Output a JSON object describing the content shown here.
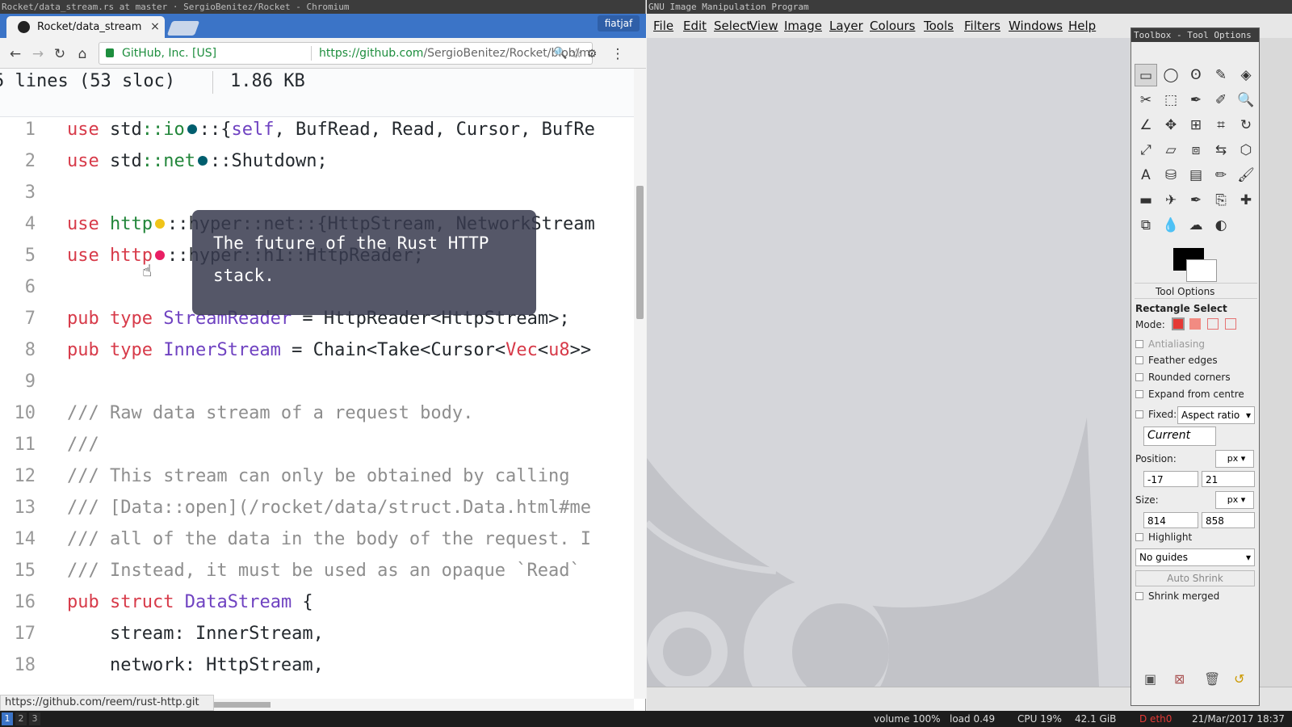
{
  "chrome": {
    "window_title": "Rocket/data_stream.rs at master · SergioBenitez/Rocket - Chromium",
    "tab_title": "Rocket/data_stream",
    "tab_close": "×",
    "profile": "fiatjaf",
    "nav": {
      "back": "←",
      "forward": "→",
      "reload": "↻",
      "home": "⌂",
      "menu": "⋮",
      "zoom": "🔍",
      "star": "☆",
      "ext": "⚙"
    },
    "secure_label": "GitHub, Inc. [US]",
    "url_host": "https://github.com",
    "url_path": "/SergioBenitez/Rocket/blob/master/lib/src/da",
    "status_url": "https://github.com/reem/rust-http.git",
    "file_info": {
      "lines": "5 lines (53 sloc)",
      "size": "1.86 KB"
    },
    "tooltip": "The future of the Rust HTTP stack.",
    "code_lines": [
      {
        "n": "1",
        "segs": [
          [
            "kw",
            "use"
          ],
          [
            "",
            "std"
          ],
          [
            "md",
            "::io"
          ],
          [
            "dot",
            "#005e6e"
          ],
          [
            "",
            "::{"
          ],
          [
            "ty",
            "self"
          ],
          [
            "",
            ", BufRead, Read, Cursor, BufRe"
          ]
        ]
      },
      {
        "n": "2",
        "segs": [
          [
            "kw",
            "use"
          ],
          [
            "",
            "std"
          ],
          [
            "md",
            "::net"
          ],
          [
            "dot",
            "#005e6e"
          ],
          [
            "",
            "::Shutdown;"
          ]
        ]
      },
      {
        "n": "3",
        "segs": []
      },
      {
        "n": "4",
        "segs": [
          [
            "kw",
            "use"
          ],
          [
            "md",
            "http"
          ],
          [
            "dot",
            "#f0c419"
          ],
          [
            "",
            "::hyper::net::{HttpStream, NetworkStream"
          ]
        ]
      },
      {
        "n": "5",
        "segs": [
          [
            "kw",
            "use"
          ],
          [
            "kw",
            "http"
          ],
          [
            "dot",
            "#e91e63"
          ],
          [
            "",
            "::hyper::h1::HttpReader;"
          ]
        ]
      },
      {
        "n": "6",
        "segs": []
      },
      {
        "n": "7",
        "segs": [
          [
            "kw",
            "pub"
          ],
          [
            "kw",
            "type"
          ],
          [
            "ty",
            "StreamReader"
          ],
          [
            "",
            " = HttpReader<HttpStream>;"
          ]
        ]
      },
      {
        "n": "8",
        "segs": [
          [
            "kw",
            "pub"
          ],
          [
            "kw",
            "type"
          ],
          [
            "ty",
            "InnerStream"
          ],
          [
            "",
            " = Chain<Take<Cursor<"
          ],
          [
            "kw",
            "Vec"
          ],
          [
            "",
            "<"
          ],
          [
            "kw",
            "u8"
          ],
          [
            "",
            ">>"
          ]
        ]
      },
      {
        "n": "9",
        "segs": []
      },
      {
        "n": "10",
        "segs": [
          [
            "cm",
            "/// Raw data stream of a request body."
          ]
        ]
      },
      {
        "n": "11",
        "segs": [
          [
            "cm",
            "///"
          ]
        ]
      },
      {
        "n": "12",
        "segs": [
          [
            "cm",
            "/// This stream can only be obtained by calling"
          ]
        ]
      },
      {
        "n": "13",
        "segs": [
          [
            "cm",
            "/// [Data::open](/rocket/data/struct.Data.html#me"
          ]
        ]
      },
      {
        "n": "14",
        "segs": [
          [
            "cm",
            "/// all of the data in the body of the request. I"
          ]
        ]
      },
      {
        "n": "15",
        "segs": [
          [
            "cm",
            "/// Instead, it must be used as an opaque `Read`"
          ]
        ]
      },
      {
        "n": "16",
        "segs": [
          [
            "kw",
            "pub"
          ],
          [
            "kw",
            "struct"
          ],
          [
            "ty",
            "DataStream"
          ],
          [
            "",
            " {"
          ]
        ]
      },
      {
        "n": "17",
        "segs": [
          [
            "",
            "    stream: InnerStream,"
          ]
        ]
      },
      {
        "n": "18",
        "segs": [
          [
            "",
            "    network: HttpStream,"
          ]
        ]
      }
    ]
  },
  "gimp": {
    "window_title": "GNU Image Manipulation Program",
    "menus": [
      "File",
      "Edit",
      "Select",
      "View",
      "Image",
      "Layer",
      "Colours",
      "Tools",
      "Filters",
      "Windows",
      "Help"
    ],
    "toolbox_title": "Toolbox - Tool Options",
    "tool_icons": [
      "rect-select-icon",
      "ellipse-select-icon",
      "lasso-icon",
      "fuzzy-select-icon",
      "select-by-color-icon",
      "scissors-icon",
      "foreground-select-icon",
      "paths-icon",
      "color-picker-icon",
      "zoom-icon",
      "measure-icon",
      "move-icon",
      "align-icon",
      "crop-icon",
      "rotate-icon",
      "scale-icon",
      "shear-icon",
      "perspective-icon",
      "flip-icon",
      "cage-icon",
      "text-icon",
      "bucket-fill-icon",
      "blend-icon",
      "pencil-icon",
      "paintbrush-icon",
      "eraser-icon",
      "airbrush-icon",
      "ink-icon",
      "clone-icon",
      "heal-icon",
      "perspective-clone-icon",
      "blur-icon",
      "smudge-icon",
      "dodge-icon"
    ],
    "tool_glyphs": [
      "▭",
      "◯",
      "ʘ",
      "✎",
      "◈",
      "✂",
      "⬚",
      "✒",
      "✐",
      "🔍",
      "∠",
      "✥",
      "⊞",
      "⌗",
      "↻",
      "⤢",
      "▱",
      "⧈",
      "⇆",
      "⬡",
      "A",
      "⛁",
      "▤",
      "✏",
      "🖌",
      "▬",
      "✈",
      "✒",
      "⎘",
      "✚",
      "⧉",
      "💧",
      "☁",
      "◐"
    ],
    "tool_options_tab": "Tool Options",
    "tool_name": "Rectangle Select",
    "mode_label": "Mode:",
    "antialiasing": "Antialiasing",
    "feather_edges": "Feather edges",
    "rounded_corners": "Rounded corners",
    "expand_from_centre": "Expand from centre",
    "fixed_label": "Fixed:",
    "fixed_value": "Aspect ratio",
    "current_value": "Current",
    "position_label": "Position:",
    "position_unit": "px",
    "position_x": "-17",
    "position_y": "21",
    "size_label": "Size:",
    "size_unit": "px",
    "size_w": "814",
    "size_h": "858",
    "highlight": "Highlight",
    "guides_value": "No guides",
    "auto_shrink": "Auto Shrink",
    "shrink_merged": "Shrink merged"
  },
  "taskbar": {
    "workspaces": [
      "1",
      "2",
      "3"
    ],
    "volume": "volume 100%",
    "load": "load 0.49",
    "cpu": "CPU 19%",
    "disk": "42.1 GiB",
    "net": "D eth0",
    "datetime": "21/Mar/2017 18:37"
  }
}
